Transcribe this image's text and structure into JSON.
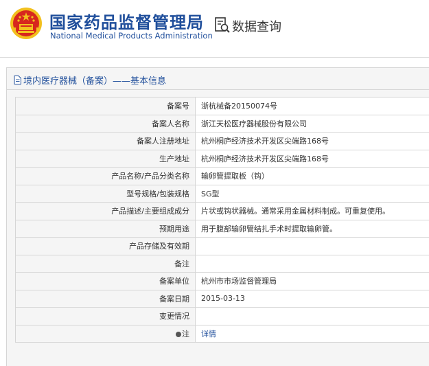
{
  "header": {
    "cn_name": "国家药品监督管理局",
    "en_name": "National Medical Products Administration",
    "query_title": "数据查询"
  },
  "panel": {
    "title": "境内医疗器械（备案）——基本信息"
  },
  "rows": [
    {
      "label": "备案号",
      "value": "浙杭械备20150074号"
    },
    {
      "label": "备案人名称",
      "value": "浙江天松医疗器械股份有限公司"
    },
    {
      "label": "备案人注册地址",
      "value": "杭州桐庐经济技术开发区尖端路168号"
    },
    {
      "label": "生产地址",
      "value": "杭州桐庐经济技术开发区尖端路168号"
    },
    {
      "label": "产品名称/产品分类名称",
      "value": "输卵管提取板（钩）"
    },
    {
      "label": "型号规格/包装规格",
      "value": "SG型"
    },
    {
      "label": "产品描述/主要组成成分",
      "value": "片状或钩状器械。通常采用金属材料制成。可重复使用。"
    },
    {
      "label": "预期用途",
      "value": "用于腹部输卵管结扎手术时提取输卵管。"
    },
    {
      "label": "产品存储及有效期",
      "value": ""
    },
    {
      "label": "备注",
      "value": ""
    },
    {
      "label": "备案单位",
      "value": "杭州市市场监督管理局"
    },
    {
      "label": "备案日期",
      "value": "2015-03-13"
    },
    {
      "label": "变更情况",
      "value": ""
    },
    {
      "label": "注",
      "value": "详情"
    }
  ],
  "colors": {
    "brand_blue": "#1f4e9b",
    "emblem_red": "#d7261e",
    "emblem_gold": "#f2c01e"
  },
  "icons": [
    "national-emblem-icon",
    "data-query-icon",
    "document-icon",
    "note-marker-icon"
  ]
}
